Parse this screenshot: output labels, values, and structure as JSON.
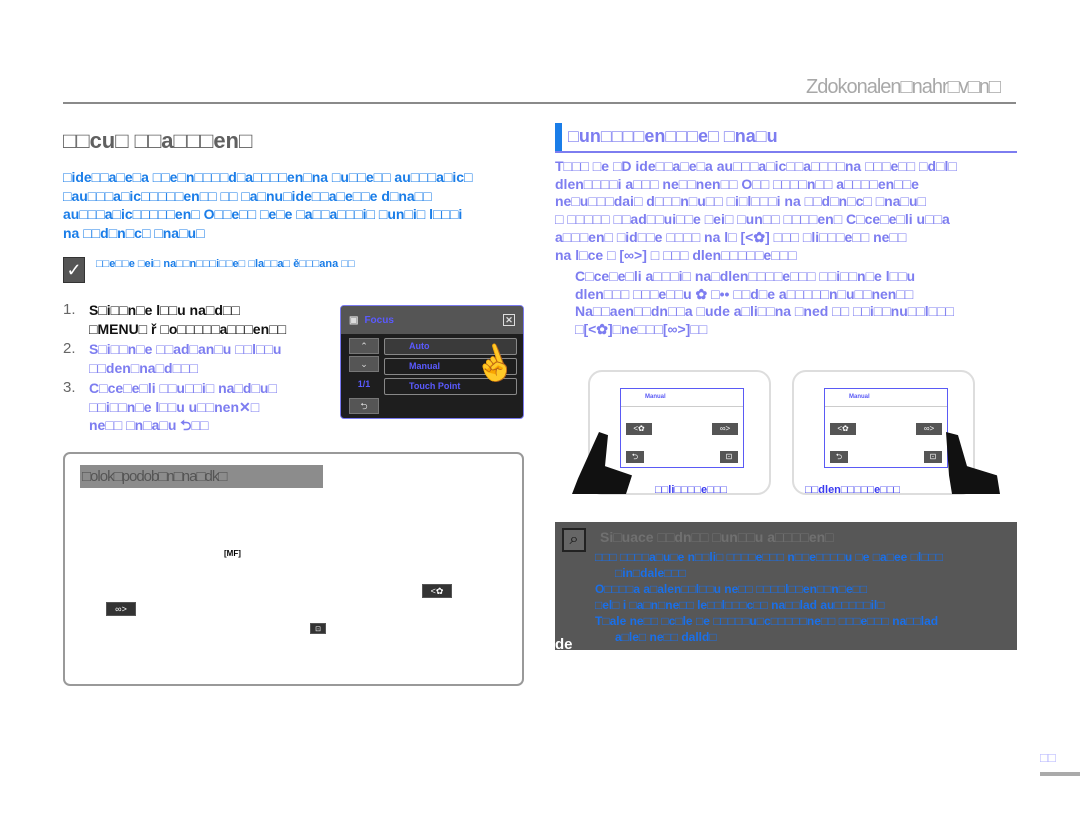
{
  "header": {
    "title": "Zdokonalen□nahr□v□n□"
  },
  "left": {
    "heading": "□□cu□ □□a□□□en□",
    "intro": [
      "□ide□□a□e□a □□e□n□□□□d□a□□□□en□na □u□□e□□ au□□□a□ic□",
      "□au□□□a□ic□□□□□en□□ □□ □a□nu□ide□□a□e□□e d□na□□",
      "au□□□a□ic□□□□□en□ O□□e□□ □e□e □a□□a□□□i□ □un□i□ l□□□i",
      "na □□d□n□c□ □na□u□"
    ],
    "note": "□□e□□e □ei□ na□□n□□□i□□e□ □la□□a□ ě□□□ana □□",
    "steps": [
      {
        "num": "1.",
        "lines": [
          "S□i□□n□e l□□u na□d□□",
          "□MENU□ ř □o□□□□□a□□□en□□"
        ]
      },
      {
        "num": "2.",
        "lines": [
          "S□i□□n□e □□ad□an□u □□l□□u",
          "□□den□na□d□□□"
        ]
      },
      {
        "num": "3.",
        "lines": [
          "C□ce□e□li □□u□□i□ na□d□u□",
          "□□i□□n□e l□□u u□□nen✕□",
          "ne□□ □n□a□u ⮌□□"
        ]
      }
    ],
    "menu_key": "MENU",
    "focus_menu": {
      "title": "Focus",
      "options": [
        "Auto",
        "Manual",
        "Touch Point"
      ],
      "page": "1/1",
      "selected": "Auto"
    },
    "tip_box": {
      "heading": "□olok□podob□n□na□dk□"
    }
  },
  "right": {
    "heading": "□un□□□□en□□□e□ □na□u",
    "paragraph": [
      "T□□□ □e □D ide□□a□e□a au□□□a□ic□□a□□□□na □□□e□□ □d□l□",
      "dlen□□□□i a□□□ ne□□nen□□ O□□ □□□□n□□ a□□□□en□□e",
      "ne□u□□□dai□ d□□□n□u□□ □i□l□□□i na □□d□n□c□ □na□u□",
      "□ □□□□□ □□ad□□ui□□e □ei□ □un□□ □□□□en□ C□ce□e□li u□□a",
      "a□□□en□ □id□□e □□□□ na l□ [<✿] □□□ □li□□□e□□ ne□□",
      "na l□ce □ [∞>] □ □□□ dlen□□□□□e□□□"
    ],
    "bullets": [
      "C□ce□e□li a□□□i□ na□dlen□□□□e□□□ □□i□□n□e l□□u",
      "dlen□□□ □□□e□□u ✿ □•• □□d□e a□□□□□n□u□□nen□□",
      "Na□□aen□□dn□□a □ude a□li□□na □ned □□ □□i□□nu□□l□□□",
      "□[<✿]□ne□□□[∞>]□□"
    ],
    "device_screen_title": "Manual",
    "captions": [
      "□□li□□□□e□□□",
      "□□dlen□□□□□e□□□"
    ],
    "situation_box": {
      "heading": "Si□uace □□dn□□ □un□□u a□□□□en□",
      "items": [
        "□□□ □□□□a□u□e n□□li□ □□□□e□□□ n□□e□□□□u □e □a□ee □l□□□",
        "□in□dale□□□",
        "O□□□□a a□alen□□l□□u ne□□ □□□□l□□en□□n□e□□",
        "□el□ i □a□n□ne□□ le□□l□□□c□□ na□□lad au□□□□□il□",
        "T□ale ne□□ □c□le □e □□□□□u□c□□□□□ne□□ □□□e□□□ na□□lad",
        "a□le□ ne□□ dalld□"
      ]
    },
    "stray_text": "de"
  },
  "page_number": "□□",
  "colors": {
    "accent_blue": "#1a7de8",
    "lavender": "#7d7df0",
    "box_gray": "#575757"
  }
}
